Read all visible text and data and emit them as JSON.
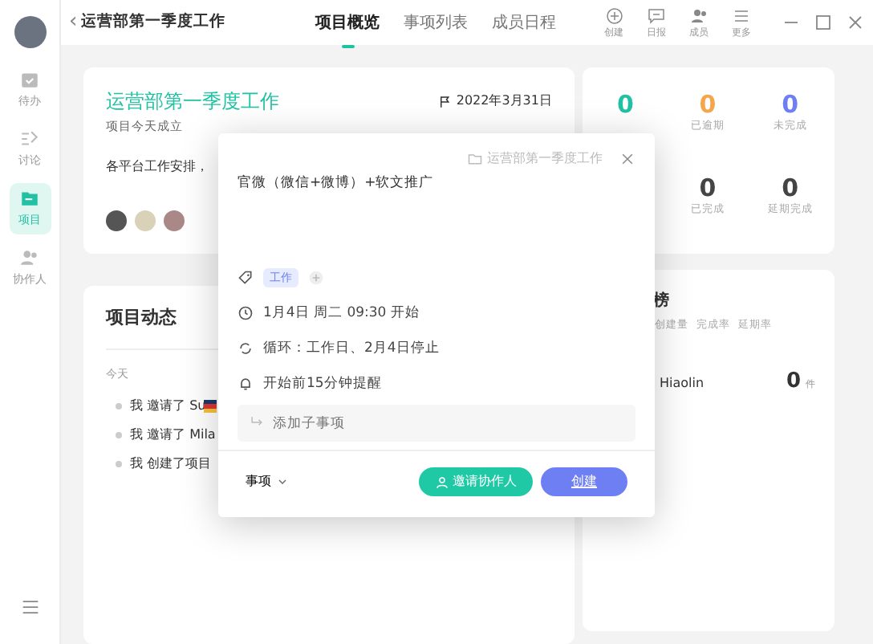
{
  "sidebar": {
    "items": [
      {
        "label": "待办",
        "selected": false
      },
      {
        "label": "讨论",
        "selected": false
      },
      {
        "label": "项目",
        "selected": true
      },
      {
        "label": "协作人",
        "selected": false
      }
    ]
  },
  "header": {
    "back": "‹",
    "title": "运营部第一季度工作",
    "tabs": [
      {
        "label": "项目概览",
        "selected": true
      },
      {
        "label": "事项列表",
        "selected": false
      },
      {
        "label": "成员日程",
        "selected": false
      }
    ],
    "tools": [
      {
        "label": "创建"
      },
      {
        "label": "日报"
      },
      {
        "label": "成员"
      },
      {
        "label": "更多"
      }
    ]
  },
  "project": {
    "title": "运营部第一季度工作",
    "deadline": "2022年3月31日",
    "subtitle": "项目今天成立",
    "description": "各平台工作安排，"
  },
  "activity": {
    "title": "项目动态",
    "day": "今天",
    "items": [
      {
        "text": "我 邀请了 Su",
        "flag": true
      },
      {
        "text": "我 邀请了 Mila",
        "flag": false
      },
      {
        "text": "我 创建了项目",
        "flag": false
      }
    ]
  },
  "stats": [
    {
      "value": "0",
      "color": "#21c2a3"
    },
    {
      "value": "0",
      "label": "已逾期",
      "color": "#f4a64a"
    },
    {
      "value": "0",
      "label": "未完成",
      "color": "#6d7ff2"
    }
  ],
  "stats_row_2": [
    {
      "value": "0",
      "label": "已完成"
    },
    {
      "value": "0",
      "label": "延期完成"
    }
  ],
  "ranking": {
    "title": "榜",
    "columns": [
      "创建量",
      "完成率",
      "延期率"
    ],
    "rows": [
      {
        "name": "Hiaolin",
        "count": "0",
        "unit": "件"
      }
    ]
  },
  "dialog": {
    "project": "运营部第一季度工作",
    "title": "官微（微信+微博）+软文推广",
    "tag": "工作",
    "rows": [
      {
        "kind": "time",
        "text": "1月4日 周二 09:30 开始"
      },
      {
        "kind": "repeat",
        "text": "循环：工作日、2月4日停止"
      },
      {
        "kind": "bell",
        "text": "开始前15分钟提醒"
      }
    ],
    "subtask": {
      "placeholder": "添加子事项"
    },
    "type": "事项",
    "invite": "邀请协作人",
    "create": "创建"
  }
}
